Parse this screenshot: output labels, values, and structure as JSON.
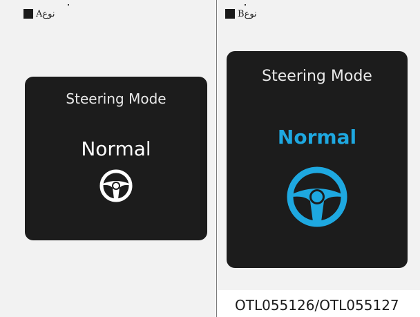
{
  "type_a": {
    "label": "نوعA"
  },
  "type_b": {
    "label": "نوعB"
  },
  "screen_a": {
    "title": "Steering Mode",
    "mode": "Normal",
    "accent_color": "#ffffff"
  },
  "screen_b": {
    "title": "Steering Mode",
    "mode": "Normal",
    "accent_color": "#1ea8e0"
  },
  "icons": {
    "square": "black-square-icon",
    "wheel": "steering-wheel-icon"
  },
  "caption": "OTL055126/OTL055127"
}
